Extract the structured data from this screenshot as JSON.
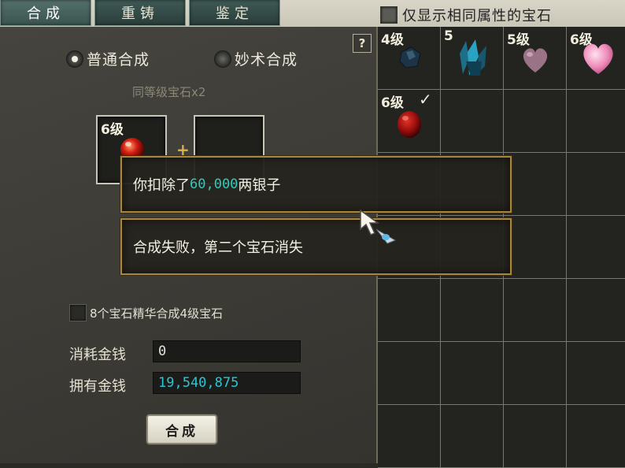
{
  "tabs": [
    {
      "label": "合成",
      "active": true
    },
    {
      "label": "重铸",
      "active": false
    },
    {
      "label": "鉴定",
      "active": false
    }
  ],
  "filter": {
    "label": "仅显示相同属性的宝石",
    "checked": false
  },
  "mode": {
    "options": [
      {
        "label": "普通合成",
        "selected": true
      },
      {
        "label": "妙术合成",
        "selected": false
      }
    ],
    "hint": "同等级宝石x2"
  },
  "slots": [
    {
      "level": "6级",
      "gem": "red-gem"
    },
    {
      "level": "",
      "gem": ""
    }
  ],
  "plus_sign": "+",
  "help": "?",
  "essence_option": {
    "label": "8个宝石精华合成4级宝石",
    "checked": false
  },
  "cost": {
    "label": "消耗金钱",
    "value": "0"
  },
  "money": {
    "label": "拥有金钱",
    "value": "19,540,875"
  },
  "combine_button": "合成",
  "inventory": [
    {
      "level": "4级",
      "gem": "dark-blue-gem",
      "checked": false
    },
    {
      "level": "5",
      "gem": "blue-crystal",
      "checked": false
    },
    {
      "level": "5级",
      "gem": "pink-heart",
      "checked": false
    },
    {
      "level": "6级",
      "gem": "bright-pink-heart",
      "checked": false
    },
    {
      "level": "6级",
      "gem": "red-gem",
      "checked": true
    }
  ],
  "messages": {
    "first_prefix": "你扣除了",
    "first_amount": "60,000",
    "first_suffix": "两银子",
    "second": "合成失败，第二个宝石消失"
  },
  "colors": {
    "accent_gold": "#a8873a",
    "money_cyan": "#28c7d6",
    "amount_teal": "#31c9b8"
  }
}
